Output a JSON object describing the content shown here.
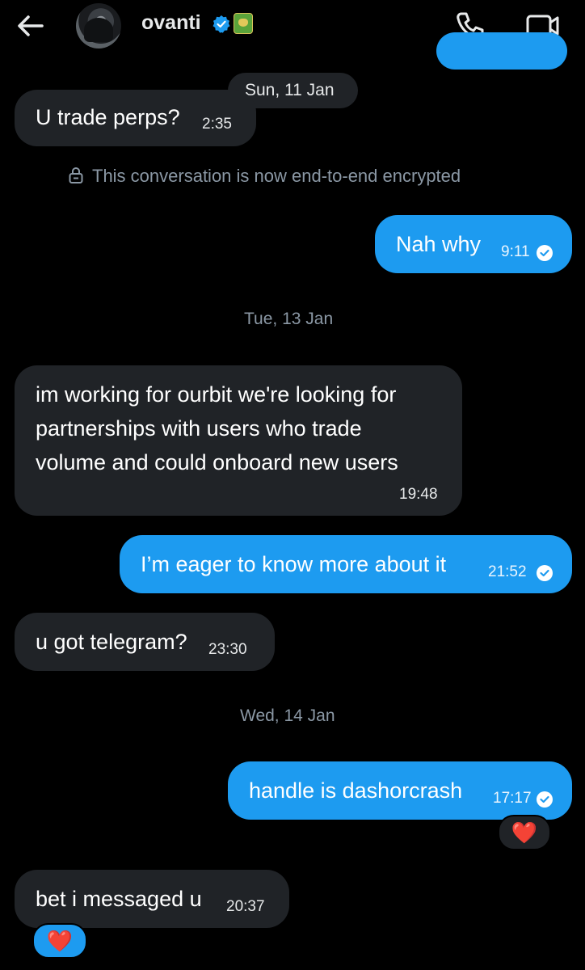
{
  "header": {
    "contact_name": "ovanti",
    "back_label": "",
    "icons": [
      "back-arrow-icon",
      "verified-badge-icon",
      "affiliate-badge-icon",
      "phone-icon",
      "video-call-icon"
    ]
  },
  "dates": {
    "d1": "Sun, 11 Jan",
    "d2": "Tue, 13 Jan",
    "d3": "Wed, 14 Jan"
  },
  "encryption_notice": "This conversation is now end-to-end encrypted",
  "messages": [
    {
      "side": "incoming",
      "text": "U trade perps?",
      "time": "2:35"
    },
    {
      "side": "outgoing",
      "text": "Nah why",
      "time": "9:11",
      "status": "read"
    },
    {
      "side": "incoming",
      "text_lines": [
        "im working for ourbit we're looking for",
        "partnerships with users who trade",
        "volume and could onboard new users"
      ],
      "time": "19:48"
    },
    {
      "side": "outgoing",
      "text": "I’m eager to know more about it",
      "time": "21:52",
      "status": "read"
    },
    {
      "side": "incoming",
      "text": "u got telegram?",
      "time": "23:30"
    },
    {
      "side": "outgoing",
      "text": "handle is dashorcrash",
      "time": "17:17",
      "status": "read",
      "reaction": "❤️"
    },
    {
      "side": "incoming",
      "text": "bet i messaged u",
      "time": "20:37",
      "reaction": "❤️"
    }
  ],
  "colors": {
    "background": "#000000",
    "incoming_bubble": "#202327",
    "outgoing_bubble": "#1d9bf0",
    "muted_text": "#8b98a5",
    "reaction_heart": "#f91880"
  }
}
